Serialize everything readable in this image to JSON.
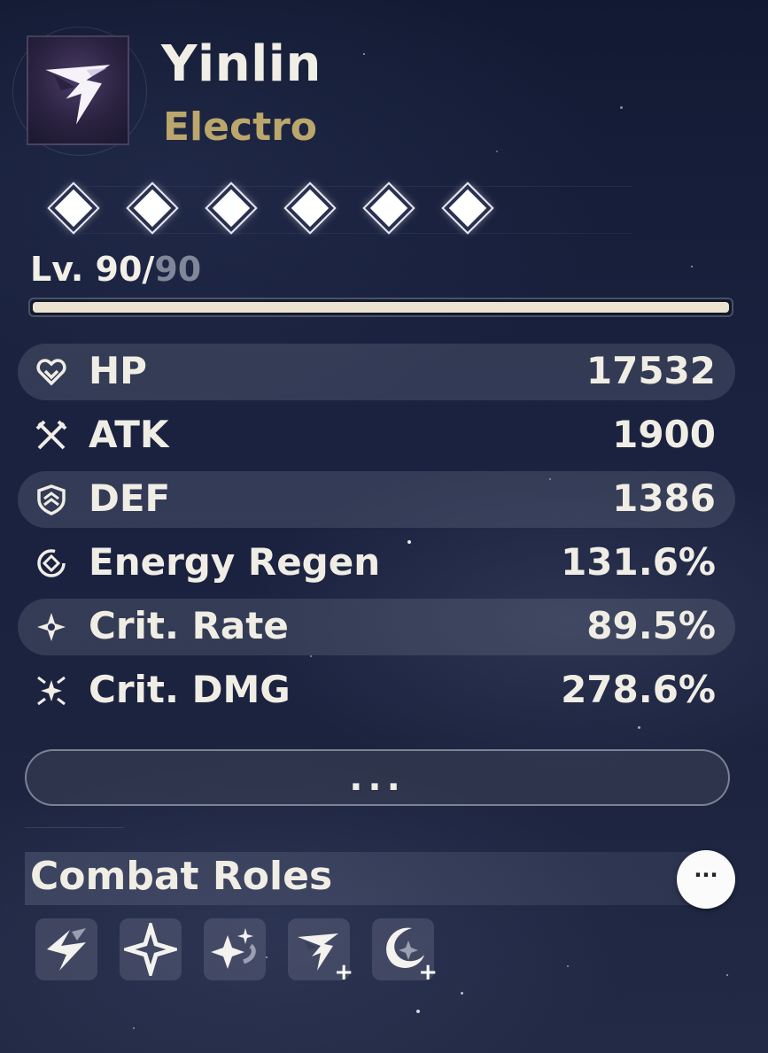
{
  "character": {
    "name": "Yinlin",
    "element": "Electro",
    "portrait_icon": "yinlin-emblem-icon",
    "resonance_chain": {
      "unlocked": 6,
      "total": 6,
      "icon": "diamond-icon"
    },
    "level": {
      "current": "Lv. 90/",
      "max": "90",
      "progress": 1.0
    }
  },
  "stats": [
    {
      "icon": "hp-heart-icon",
      "label": "HP",
      "value": "17532"
    },
    {
      "icon": "atk-crossed-swords-icon",
      "label": "ATK",
      "value": "1900"
    },
    {
      "icon": "def-shield-icon",
      "label": "DEF",
      "value": "1386"
    },
    {
      "icon": "energy-regen-icon",
      "label": "Energy Regen",
      "value": "131.6%"
    },
    {
      "icon": "crit-rate-star-icon",
      "label": "Crit. Rate",
      "value": "89.5%"
    },
    {
      "icon": "crit-dmg-burst-icon",
      "label": "Crit. DMG",
      "value": "278.6%"
    }
  ],
  "more_button": {
    "label": "..."
  },
  "combat_roles": {
    "title": "Combat Roles",
    "menu_button_label": "···",
    "roles": [
      {
        "icon": "electro-role-icon"
      },
      {
        "icon": "four-point-star-role-icon"
      },
      {
        "icon": "sparkle-swirl-role-icon"
      },
      {
        "icon": "emblem-plus-role-icon"
      },
      {
        "icon": "crescent-star-plus-role-icon"
      }
    ]
  },
  "colors": {
    "accent_gold": "#bba66c",
    "text": "#f0ede5",
    "level_bar": "#ebe3cf",
    "background": "#1a2240"
  }
}
